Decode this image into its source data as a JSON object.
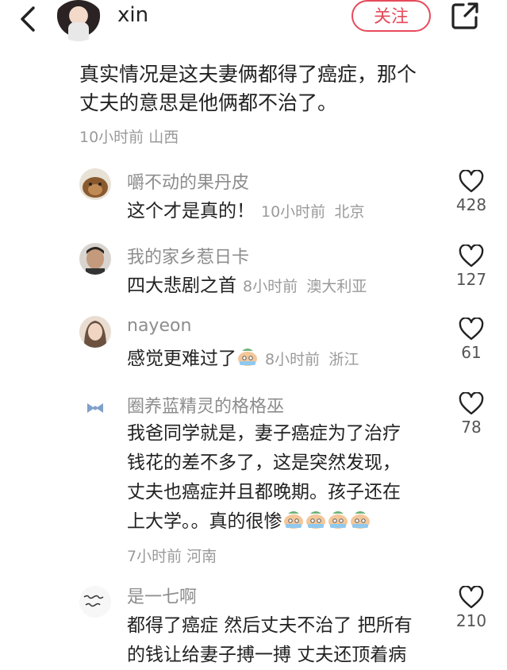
{
  "header": {
    "user_name": "xin",
    "follow_label": "关注"
  },
  "post": {
    "text_line1": "真实情况是这夫妻俩都得了癌症，那个",
    "text_line2": "丈夫的意思是他俩都不治了。",
    "time": "10小时前",
    "location": "山西"
  },
  "comments": [
    {
      "name": "嚼不动的果丹皮",
      "text": "这个才是真的！",
      "time": "10小时前",
      "location": "北京",
      "likes": "428"
    },
    {
      "name": "我的家乡惹日卡",
      "text": "四大悲剧之首",
      "time": "8小时前",
      "location": "澳大利亚",
      "likes": "127"
    },
    {
      "name": "nayeon",
      "text": "感觉更难过了",
      "time": "8小时前",
      "location": "浙江",
      "likes": "61"
    },
    {
      "name": "圈养蓝精灵的格格巫",
      "text_lines": [
        "我爸同学就是，妻子癌症为了治疗",
        "钱花的差不多了，这是突然发现，",
        "丈夫也癌症并且都晚期。孩子还在",
        "上大学。。真的很惨"
      ],
      "time": "7小时前",
      "location": "河南",
      "likes": "78"
    },
    {
      "name": "是一七啊",
      "text_lines": [
        "都得了癌症 然后丈夫不治了 把所有",
        "的钱让给妻子搏一搏 丈夫还顶着病"
      ],
      "likes": "210"
    }
  ],
  "icons": {
    "back": "chevron-left-icon",
    "share": "share-icon",
    "like": "heart-outline-icon",
    "emoji": "crying-emoji-icon"
  },
  "colors": {
    "accent": "#e64a5a",
    "meta_text": "#9a9a9a",
    "name_text": "#8d8d8d"
  }
}
